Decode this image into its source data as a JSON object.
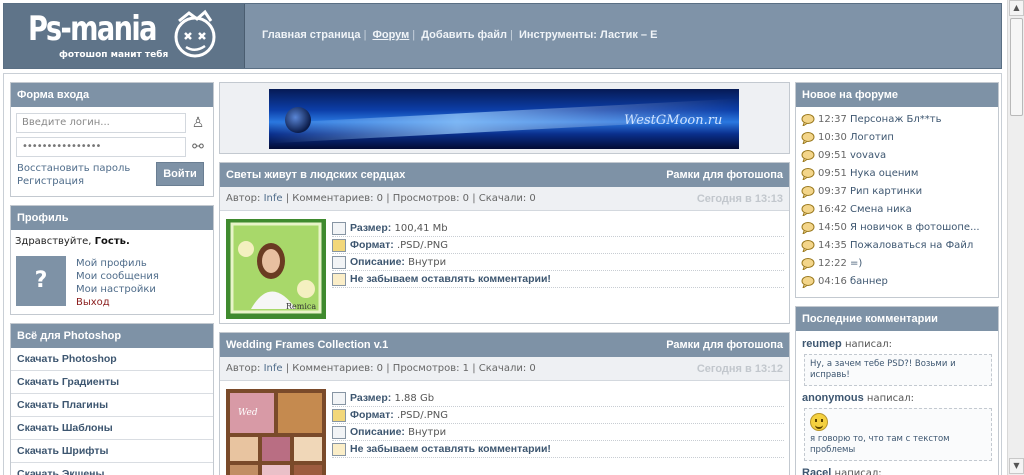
{
  "header": {
    "logo_title": "Ps-mania",
    "logo_subtitle": "фотошоп манит тебя",
    "nav": [
      {
        "label": "Главная страница",
        "active": false
      },
      {
        "label": "Форум",
        "active": true
      },
      {
        "label": "Добавить файл",
        "active": false
      },
      {
        "label": "Инструменты: Ластик – Е",
        "active": false
      }
    ]
  },
  "login": {
    "title": "Форма входа",
    "login_placeholder": "Введите логин...",
    "password_value": "••••••••••••••••",
    "restore_label": "Восстановить пароль",
    "register_label": "Регистрация",
    "submit_label": "Войти"
  },
  "profile": {
    "title": "Профиль",
    "greeting": "Здравствуйте, ",
    "guest": "Гость.",
    "avatar_symbol": "?",
    "links": [
      "Мой профиль",
      "Мои сообщения",
      "Мои настройки",
      "Выход"
    ]
  },
  "photoshop": {
    "title": "Всё для Photoshop",
    "items": [
      "Скачать Photoshop",
      "Скачать Градиенты",
      "Скачать Плагины",
      "Скачать Шаблоны",
      "Скачать Шрифты",
      "Скачать Экшены"
    ]
  },
  "banner": {
    "text": "WestGMoon.ru"
  },
  "articles": [
    {
      "title": "Светы живут в людских сердцах",
      "category": "Рамки для фотошопа",
      "author_label": "Автор:",
      "author": "Infe",
      "comments": "Комментариев: 0",
      "views": "Просмотров: 0",
      "downloads": "Скачали: 0",
      "date": "Сегодня в 13:13",
      "size_label": "Размер:",
      "size": "100,41 Mb",
      "format_label": "Формат:",
      "format": ".PSD/.PNG",
      "desc_label": "Описание:",
      "desc": "Внутри",
      "reminder": "Не забываем оставлять комментарии!"
    },
    {
      "title": "Wedding Frames Collection v.1",
      "category": "Рамки для фотошопа",
      "author_label": "Автор:",
      "author": "Infe",
      "comments": "Комментариев: 0",
      "views": "Просмотров: 1",
      "downloads": "Скачали: 0",
      "date": "Сегодня в 13:12",
      "size_label": "Размер:",
      "size": "1.88 Gb",
      "format_label": "Формат:",
      "format": ".PSD/.PNG",
      "desc_label": "Описание:",
      "desc": "Внутри",
      "reminder": "Не забываем оставлять комментарии!"
    }
  ],
  "forum": {
    "title": "Новое на форуме",
    "items": [
      {
        "time": "12:37",
        "title": "Персонаж Бл**ть"
      },
      {
        "time": "10:30",
        "title": "Логотип"
      },
      {
        "time": "09:51",
        "title": "vovava"
      },
      {
        "time": "09:51",
        "title": "Нука оценим"
      },
      {
        "time": "09:37",
        "title": "Рип картинки"
      },
      {
        "time": "16:42",
        "title": "Смена ника"
      },
      {
        "time": "14:50",
        "title": "Я новичок в фотошопе..."
      },
      {
        "time": "14:35",
        "title": "Пожаловаться на Файл"
      },
      {
        "time": "12:22",
        "title": "=)"
      },
      {
        "time": "04:16",
        "title": "баннер"
      }
    ]
  },
  "comments": {
    "title": "Последние комментарии",
    "wrote": "написал:",
    "items": [
      {
        "user": "reumep",
        "text": "Ну, а зачем тебе PSD?! Возьми и исправь!"
      },
      {
        "user": "anonymous",
        "text": "я говорю то, что там с текстом проблемы"
      },
      {
        "user": "Racel",
        "text": ""
      }
    ]
  }
}
